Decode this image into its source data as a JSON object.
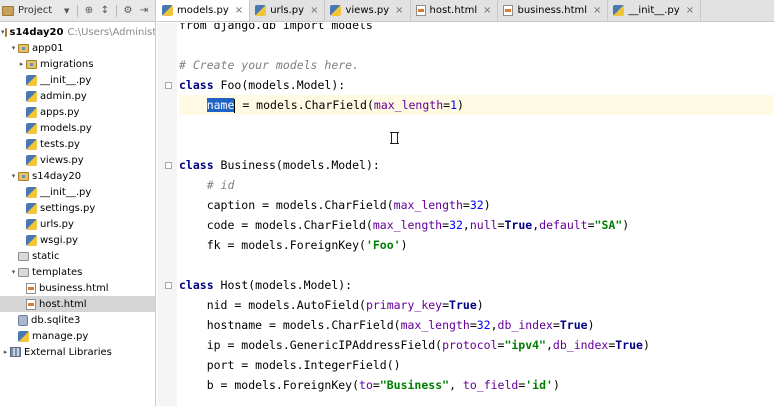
{
  "project_panel": {
    "header_label": "Project",
    "header_buttons": [
      "⊕",
      "↕",
      "⚙",
      "⇥"
    ],
    "tree": [
      {
        "label": "s14day20",
        "detail": "C:\\Users\\Administrato",
        "indent": 0,
        "expanded": true,
        "icon": "folder-icon",
        "root": true
      },
      {
        "label": "app01",
        "indent": 1,
        "expanded": true,
        "icon": "package-folder-icon"
      },
      {
        "label": "migrations",
        "indent": 2,
        "expanded": false,
        "icon": "package-folder-icon"
      },
      {
        "label": "__init__.py",
        "indent": 2,
        "icon": "python-file-icon"
      },
      {
        "label": "admin.py",
        "indent": 2,
        "icon": "python-file-icon"
      },
      {
        "label": "apps.py",
        "indent": 2,
        "icon": "python-file-icon"
      },
      {
        "label": "models.py",
        "indent": 2,
        "icon": "python-file-icon"
      },
      {
        "label": "tests.py",
        "indent": 2,
        "icon": "python-file-icon"
      },
      {
        "label": "views.py",
        "indent": 2,
        "icon": "python-file-icon"
      },
      {
        "label": "s14day20",
        "indent": 1,
        "expanded": true,
        "icon": "package-folder-icon"
      },
      {
        "label": "__init__.py",
        "indent": 2,
        "icon": "python-file-icon"
      },
      {
        "label": "settings.py",
        "indent": 2,
        "icon": "python-file-icon"
      },
      {
        "label": "urls.py",
        "indent": 2,
        "icon": "python-file-icon"
      },
      {
        "label": "wsgi.py",
        "indent": 2,
        "icon": "python-file-icon"
      },
      {
        "label": "static",
        "indent": 1,
        "icon": "plain-folder-icon"
      },
      {
        "label": "templates",
        "indent": 1,
        "expanded": true,
        "icon": "plain-folder-icon"
      },
      {
        "label": "business.html",
        "indent": 2,
        "icon": "html-file-icon"
      },
      {
        "label": "host.html",
        "indent": 2,
        "icon": "html-file-icon",
        "selected": true
      },
      {
        "label": "db.sqlite3",
        "indent": 1,
        "icon": "database-file-icon"
      },
      {
        "label": "manage.py",
        "indent": 1,
        "icon": "python-file-icon"
      },
      {
        "label": "External Libraries",
        "indent": 0,
        "expanded": false,
        "icon": "library-icon"
      }
    ]
  },
  "tabs": [
    {
      "label": "models.py",
      "icon": "python-file-icon",
      "active": true
    },
    {
      "label": "urls.py",
      "icon": "python-file-icon"
    },
    {
      "label": "views.py",
      "icon": "python-file-icon"
    },
    {
      "label": "host.html",
      "icon": "html-file-icon"
    },
    {
      "label": "business.html",
      "icon": "html-file-icon"
    },
    {
      "label": "__init__.py",
      "icon": "python-file-icon"
    }
  ],
  "tab_close_glyph": "×",
  "editor": {
    "current_line_index": 3,
    "lines": [
      [
        {
          "t": "from django.db import models",
          "c": "partial"
        }
      ],
      [],
      [
        {
          "t": "# Create your models here.",
          "c": "cmt"
        }
      ],
      [
        {
          "t": "class ",
          "c": "kw"
        },
        {
          "t": "Foo(models.Model):"
        }
      ],
      [
        {
          "t": "    "
        },
        {
          "t": "name",
          "c": "sel"
        },
        {
          "t": "",
          "c": "caret"
        },
        {
          "t": " = models.CharField("
        },
        {
          "t": "max_length",
          "c": "arg"
        },
        {
          "t": "="
        },
        {
          "t": "1",
          "c": "num"
        },
        {
          "t": ")"
        }
      ],
      [],
      [],
      [
        {
          "t": "class ",
          "c": "kw"
        },
        {
          "t": "Business(models.Model):"
        }
      ],
      [
        {
          "t": "    "
        },
        {
          "t": "# id",
          "c": "cmt"
        }
      ],
      [
        {
          "t": "    caption = models.CharField("
        },
        {
          "t": "max_length",
          "c": "arg"
        },
        {
          "t": "="
        },
        {
          "t": "32",
          "c": "num"
        },
        {
          "t": ")"
        }
      ],
      [
        {
          "t": "    code = models.CharField("
        },
        {
          "t": "max_length",
          "c": "arg"
        },
        {
          "t": "="
        },
        {
          "t": "32",
          "c": "num"
        },
        {
          "t": ","
        },
        {
          "t": "null",
          "c": "arg"
        },
        {
          "t": "="
        },
        {
          "t": "True",
          "c": "kw"
        },
        {
          "t": ","
        },
        {
          "t": "default",
          "c": "arg"
        },
        {
          "t": "="
        },
        {
          "t": "\"SA\"",
          "c": "str"
        },
        {
          "t": ")"
        }
      ],
      [
        {
          "t": "    fk = models.ForeignKey("
        },
        {
          "t": "'Foo'",
          "c": "str"
        },
        {
          "t": ")"
        }
      ],
      [],
      [
        {
          "t": "class ",
          "c": "kw"
        },
        {
          "t": "Host(models.Model):"
        }
      ],
      [
        {
          "t": "    nid = models.AutoField("
        },
        {
          "t": "primary_key",
          "c": "arg"
        },
        {
          "t": "="
        },
        {
          "t": "True",
          "c": "kw"
        },
        {
          "t": ")"
        }
      ],
      [
        {
          "t": "    hostname = models.CharField("
        },
        {
          "t": "max_length",
          "c": "arg"
        },
        {
          "t": "="
        },
        {
          "t": "32",
          "c": "num"
        },
        {
          "t": ","
        },
        {
          "t": "db_index",
          "c": "arg"
        },
        {
          "t": "="
        },
        {
          "t": "True",
          "c": "kw"
        },
        {
          "t": ")"
        }
      ],
      [
        {
          "t": "    ip = models.GenericIPAddressField("
        },
        {
          "t": "protocol",
          "c": "arg"
        },
        {
          "t": "="
        },
        {
          "t": "\"ipv4\"",
          "c": "str"
        },
        {
          "t": ","
        },
        {
          "t": "db_index",
          "c": "arg"
        },
        {
          "t": "="
        },
        {
          "t": "True",
          "c": "kw"
        },
        {
          "t": ")"
        }
      ],
      [
        {
          "t": "    port = models.IntegerField()"
        }
      ],
      [
        {
          "t": "    b = models.ForeignKey("
        },
        {
          "t": "to",
          "c": "arg"
        },
        {
          "t": "="
        },
        {
          "t": "\"Business\"",
          "c": "str"
        },
        {
          "t": ", "
        },
        {
          "t": "to_field",
          "c": "arg"
        },
        {
          "t": "="
        },
        {
          "t": "'id'",
          "c": "str"
        },
        {
          "t": ")"
        }
      ]
    ]
  }
}
